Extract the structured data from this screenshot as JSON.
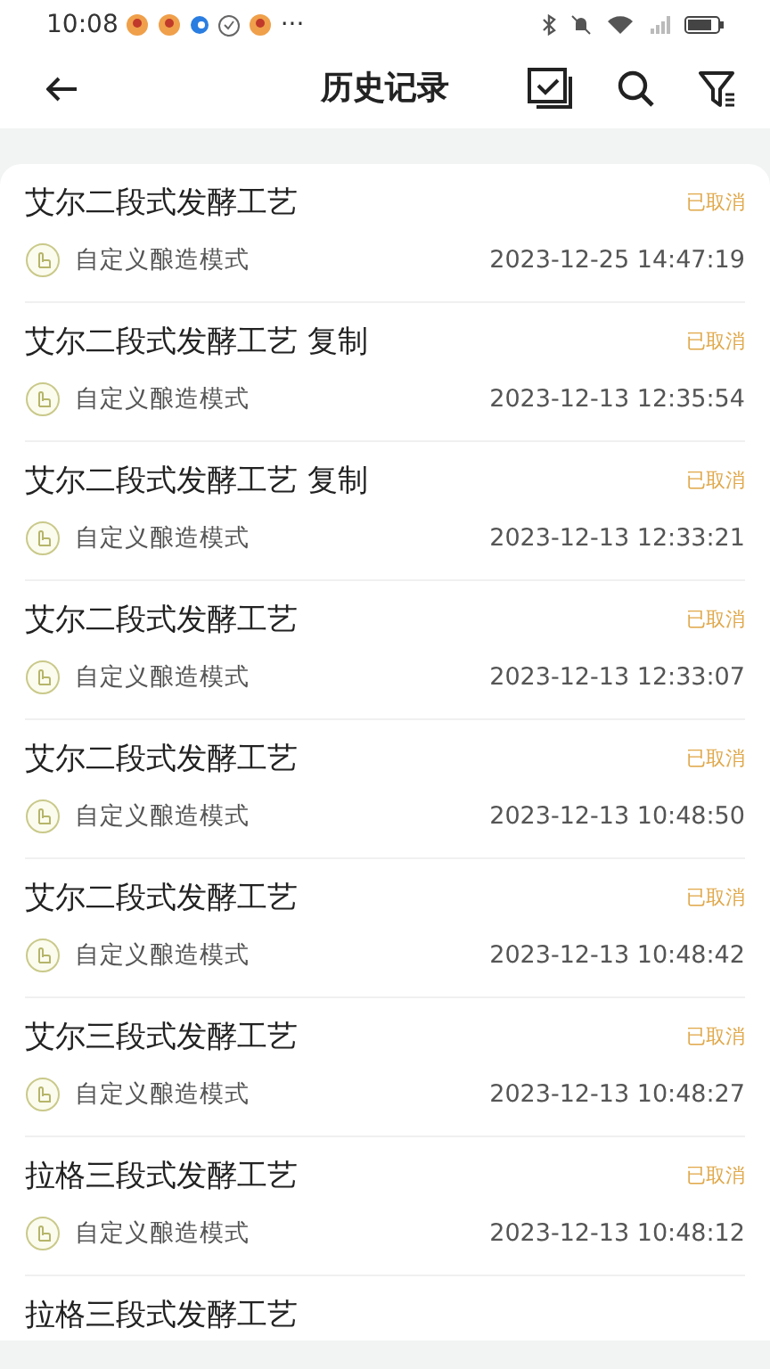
{
  "status_bar": {
    "time": "10:08",
    "more": "···"
  },
  "header": {
    "title": "历史记录"
  },
  "records": [
    {
      "title": "艾尔二段式发酵工艺",
      "status": "已取消",
      "mode": "自定义酿造模式",
      "datetime": "2023-12-25 14:47:19"
    },
    {
      "title": "艾尔二段式发酵工艺 复制",
      "status": "已取消",
      "mode": "自定义酿造模式",
      "datetime": "2023-12-13 12:35:54"
    },
    {
      "title": "艾尔二段式发酵工艺 复制",
      "status": "已取消",
      "mode": "自定义酿造模式",
      "datetime": "2023-12-13 12:33:21"
    },
    {
      "title": "艾尔二段式发酵工艺",
      "status": "已取消",
      "mode": "自定义酿造模式",
      "datetime": "2023-12-13 12:33:07"
    },
    {
      "title": "艾尔二段式发酵工艺",
      "status": "已取消",
      "mode": "自定义酿造模式",
      "datetime": "2023-12-13 10:48:50"
    },
    {
      "title": "艾尔二段式发酵工艺",
      "status": "已取消",
      "mode": "自定义酿造模式",
      "datetime": "2023-12-13 10:48:42"
    },
    {
      "title": "艾尔三段式发酵工艺",
      "status": "已取消",
      "mode": "自定义酿造模式",
      "datetime": "2023-12-13 10:48:27"
    },
    {
      "title": "拉格三段式发酵工艺",
      "status": "已取消",
      "mode": "自定义酿造模式",
      "datetime": "2023-12-13 10:48:12"
    },
    {
      "title": "拉格三段式发酵工艺"
    }
  ]
}
